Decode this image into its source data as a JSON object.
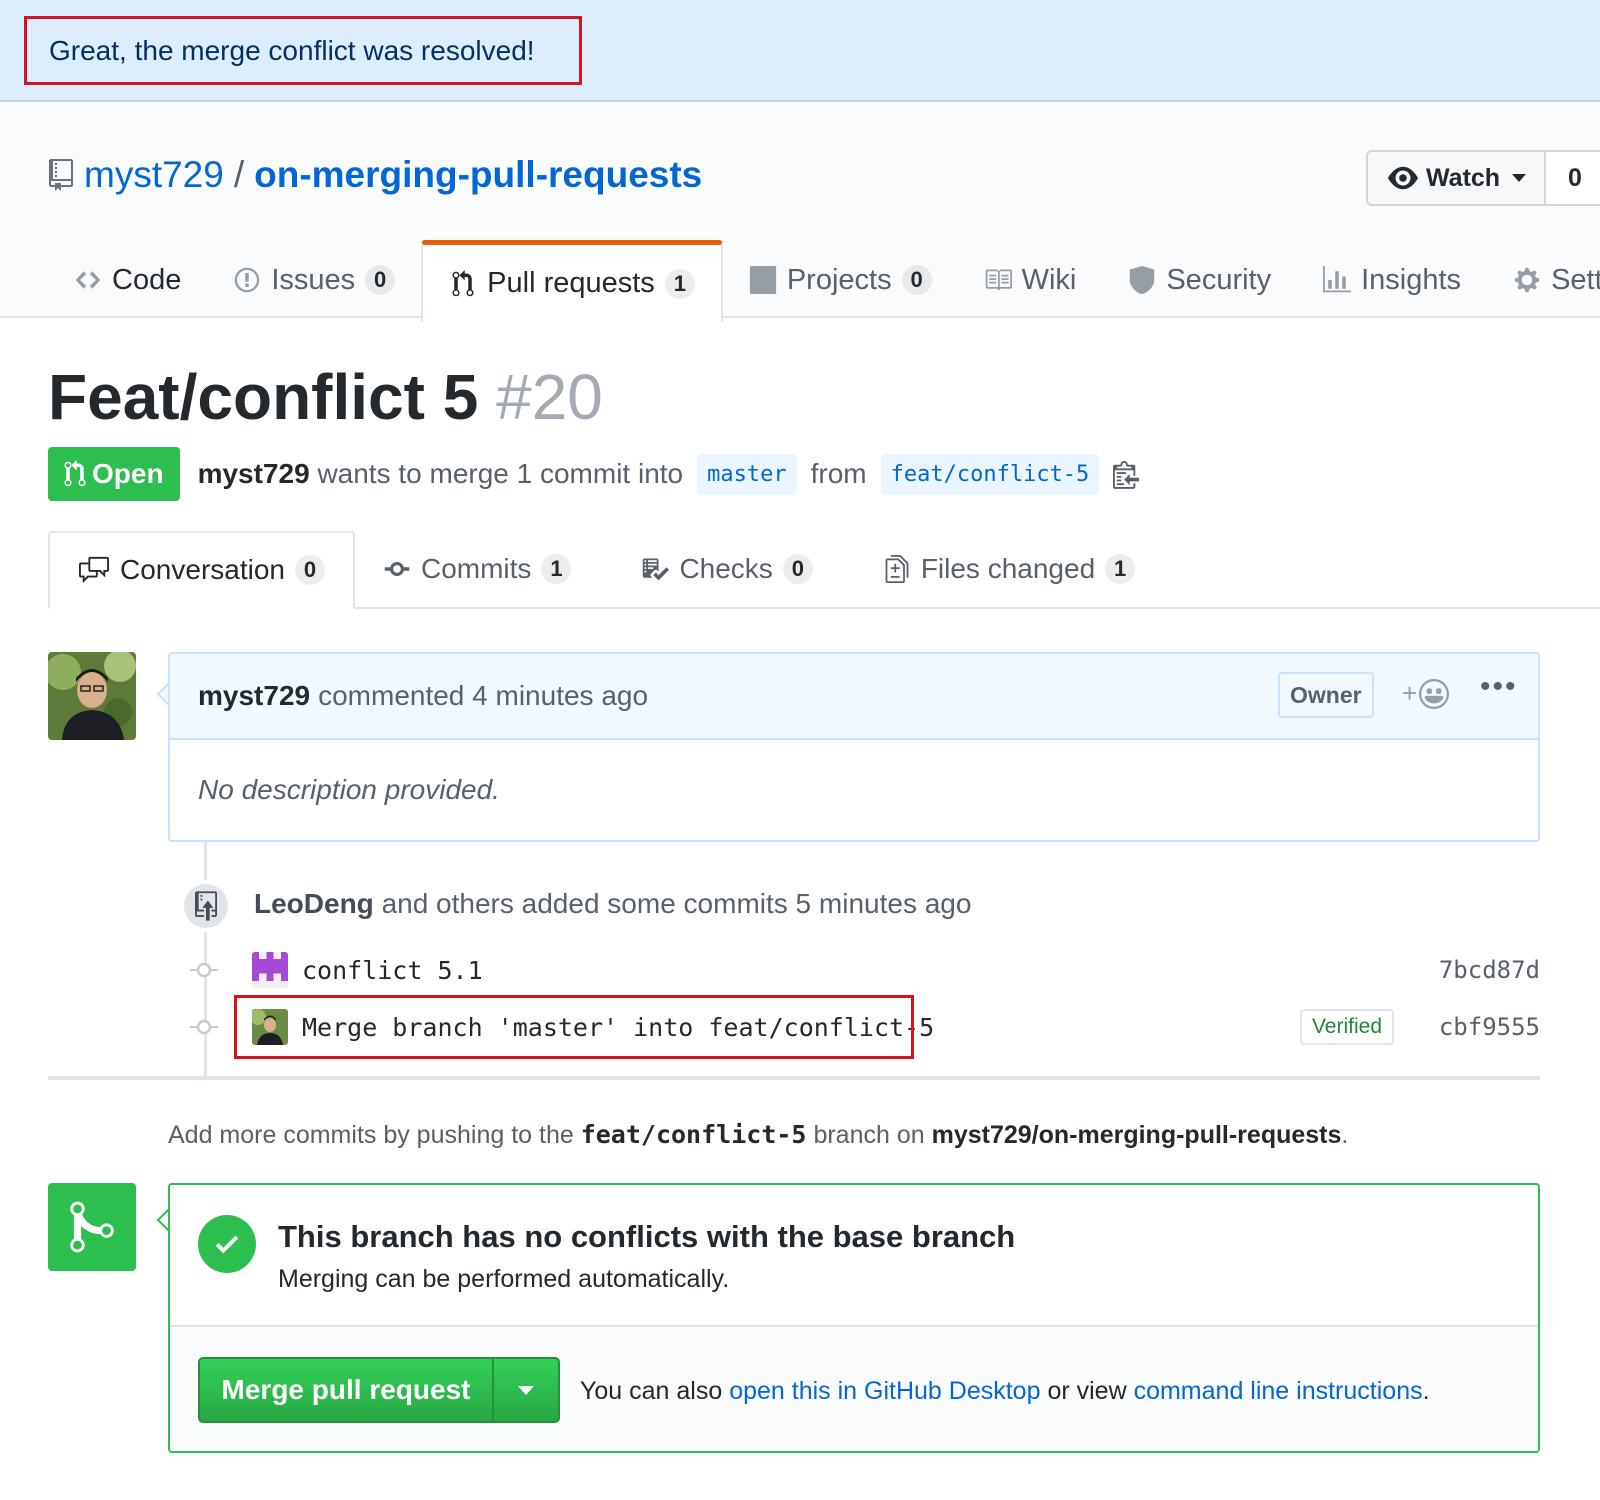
{
  "flash": {
    "message": "Great, the merge conflict was resolved!"
  },
  "repo": {
    "owner": "myst729",
    "separator": "/",
    "name": "on-merging-pull-requests",
    "icon": "repo-icon"
  },
  "watch": {
    "label": "Watch",
    "count": "0"
  },
  "repo_tabs": [
    {
      "label": "Code",
      "icon": "code-icon"
    },
    {
      "label": "Issues",
      "count": "0",
      "icon": "issue-icon"
    },
    {
      "label": "Pull requests",
      "count": "1",
      "icon": "pull-request-icon",
      "selected": true
    },
    {
      "label": "Projects",
      "count": "0",
      "icon": "project-icon"
    },
    {
      "label": "Wiki",
      "icon": "book-icon"
    },
    {
      "label": "Security",
      "icon": "shield-icon"
    },
    {
      "label": "Insights",
      "icon": "graph-icon"
    },
    {
      "label": "Settin",
      "icon": "gear-icon"
    }
  ],
  "pr": {
    "title": "Feat/conflict 5",
    "number": "#20",
    "state": "Open",
    "author": "myst729",
    "merge_text_1": "wants to merge 1 commit into",
    "base": "master",
    "merge_text_2": "from",
    "head": "feat/conflict-5"
  },
  "pr_tabs": [
    {
      "label": "Conversation",
      "count": "0",
      "icon": "comment-discussion-icon",
      "selected": true
    },
    {
      "label": "Commits",
      "count": "1",
      "icon": "git-commit-icon"
    },
    {
      "label": "Checks",
      "count": "0",
      "icon": "checklist-icon"
    },
    {
      "label": "Files changed",
      "count": "1",
      "icon": "diff-icon"
    }
  ],
  "comment": {
    "author": "myst729",
    "action": "commented 4 minutes ago",
    "badge": "Owner",
    "body": "No description provided."
  },
  "commits": {
    "author": "LeoDeng",
    "summary": "and others added some commits 5 minutes ago",
    "items": [
      {
        "message": "conflict 5.1",
        "sha": "7bcd87d"
      },
      {
        "message": "Merge branch 'master' into feat/conflict-5",
        "sha": "cbf9555",
        "verified": "Verified"
      }
    ]
  },
  "push_info": {
    "text_1": "Add more commits by pushing to the",
    "branch": "feat/conflict-5",
    "text_2": "branch on",
    "repo": "myst729/on-merging-pull-requests",
    "text_3": "."
  },
  "merge": {
    "title": "This branch has no conflicts with the base branch",
    "subtitle": "Merging can be performed automatically.",
    "button": "Merge pull request",
    "also_1": "You can also",
    "link_desktop": "open this in GitHub Desktop",
    "also_2": "or view",
    "link_cli": "command line instructions",
    "also_3": "."
  },
  "colors": {
    "accent": "#0366d6",
    "success": "#2cbe4e",
    "highlight": "#d3141c",
    "tab_accent": "#e36209"
  }
}
